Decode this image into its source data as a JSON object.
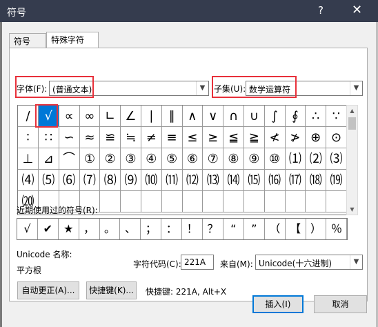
{
  "window": {
    "title": "符号",
    "help": "?",
    "close": "✕"
  },
  "tabs": [
    {
      "label": "符号(S)"
    },
    {
      "label": "特殊字符(P)"
    }
  ],
  "font": {
    "label": "字体(F):",
    "value": "(普通文本)"
  },
  "subset": {
    "label": "子集(U):",
    "value": "数学运算符"
  },
  "symbols": [
    [
      "∕",
      "√",
      "∝",
      "∞",
      "∟",
      "∠",
      "∣",
      "∥",
      "∧",
      "∨",
      "∩",
      "∪",
      "∫",
      "∮",
      "∴",
      "∵"
    ],
    [
      "∶",
      "∷",
      "∽",
      "≈",
      "≌",
      "≒",
      "≠",
      "≡",
      "≤",
      "≥",
      "≦",
      "≧",
      "≮",
      "≯",
      "⊕",
      "⊙"
    ],
    [
      "⊥",
      "⊿",
      "⌒",
      "①",
      "②",
      "③",
      "④",
      "⑤",
      "⑥",
      "⑦",
      "⑧",
      "⑨",
      "⑩",
      "⑴",
      "⑵",
      "⑶"
    ],
    [
      "⑷",
      "⑸",
      "⑹",
      "⑺",
      "⑻",
      "⑼",
      "⑽",
      "⑾",
      "⑿",
      "⒀",
      "⒁",
      "⒂",
      "⒃",
      "⒄",
      "⒅",
      "⒆"
    ],
    [
      "⒇",
      "",
      "",
      "",
      "",
      "",
      "",
      "",
      "",
      "",
      "",
      "",
      "",
      "",
      "",
      ""
    ]
  ],
  "selected_symbol": {
    "row": 0,
    "col": 1
  },
  "recent": {
    "label": "近期使用过的符号(R):",
    "items": [
      "√",
      "✔",
      "★",
      "，",
      "。",
      "、",
      "；",
      "：",
      "！",
      "？",
      "“",
      "”",
      "（",
      "【",
      "）",
      "％"
    ]
  },
  "unicode": {
    "label": "Unicode 名称:",
    "name": "平方根"
  },
  "char_code": {
    "label": "字符代码(C):",
    "value": "221A"
  },
  "from": {
    "label": "来自(M):",
    "value": "Unicode(十六进制)"
  },
  "buttons": {
    "autocorrect": "自动更正(A)...",
    "shortcut": "快捷键(K)...",
    "shortcut_info": "快捷键: 221A, Alt+X",
    "insert": "插入(I)",
    "cancel": "取消"
  }
}
